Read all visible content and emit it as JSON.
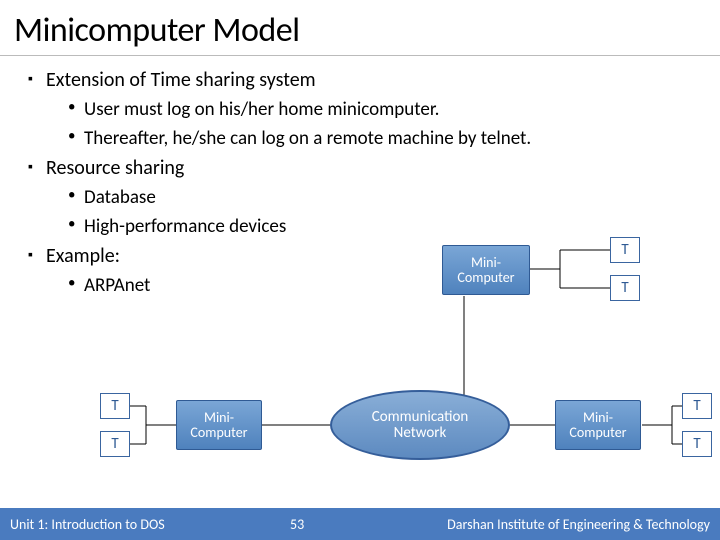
{
  "title": "Minicomputer Model",
  "bullets": {
    "b1": "Extension of Time sharing system",
    "b1a": "User must log on his/her home minicomputer.",
    "b1b": "Thereafter, he/she can log on a remote machine by telnet.",
    "b2": "Resource sharing",
    "b2a": "Database",
    "b2b": "High-performance devices",
    "b3": "Example:",
    "b3a": "ARPAnet"
  },
  "diagram": {
    "miniLabel": "Mini-\nComputer",
    "networkLabel": "Communication\nNetwork",
    "terminal": "T"
  },
  "footer": {
    "left": "Unit 1: Introduction to DOS",
    "page": "53",
    "right": "Darshan Institute of Engineering & Technology"
  }
}
